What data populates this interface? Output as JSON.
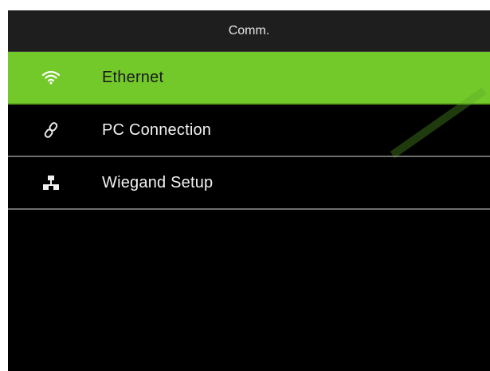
{
  "header": {
    "title": "Comm."
  },
  "menu": {
    "items": [
      {
        "label": "Ethernet",
        "icon": "wifi-icon",
        "selected": true
      },
      {
        "label": "PC Connection",
        "icon": "link-icon",
        "selected": false
      },
      {
        "label": "Wiegand Setup",
        "icon": "network-icon",
        "selected": false
      }
    ]
  },
  "colors": {
    "selected_background": "#73c82a",
    "screen_background": "#000000",
    "title_background": "#1e1e1e"
  }
}
